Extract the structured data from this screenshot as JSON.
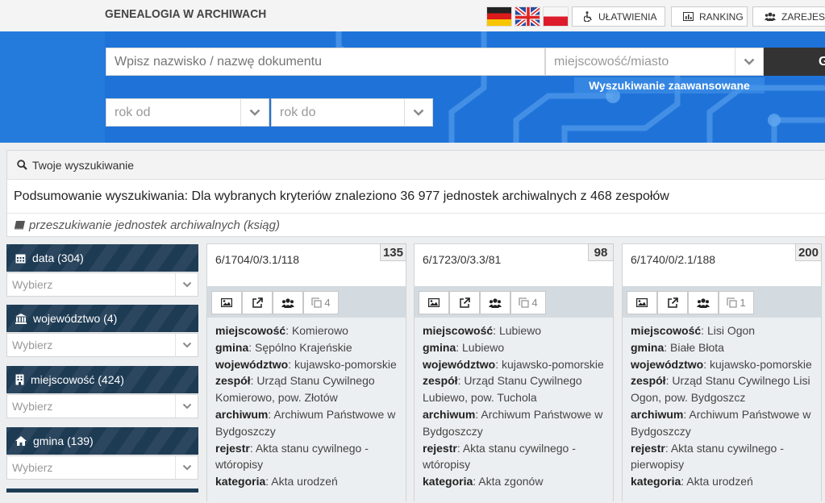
{
  "header": {
    "logo": "GENEALOGIA W ARCHIWACH",
    "buttons": {
      "accessibility": "UŁATWIENIA",
      "ranking": "RANKING",
      "register": "ZAREJESTRUJ"
    }
  },
  "search": {
    "name_placeholder": "Wpisz nazwisko / nazwę dokumentu",
    "city_placeholder": "miejscowość/miasto",
    "submit_label": "G",
    "advanced_label": "Wyszukiwanie zaawansowane",
    "year_from_placeholder": "rok od",
    "year_to_placeholder": "rok do"
  },
  "summary": {
    "heading": "Twoje wyszukiwanie",
    "text": "Podsumowanie wyszukiwania: Dla wybranych kryteriów znaleziono 36 977 jednostek archiwalnych z 468 zespołów",
    "mode": "przeszukiwanie jednostek archiwalnych (ksiąg)"
  },
  "filters": [
    {
      "label": "data (304)",
      "select": "Wybierz",
      "icon": "calendar-icon"
    },
    {
      "label": "województwo (4)",
      "select": "Wybierz",
      "icon": "bank-icon"
    },
    {
      "label": "miejscowość (424)",
      "select": "Wybierz",
      "icon": "building-icon"
    },
    {
      "label": "gmina (139)",
      "select": "Wybierz",
      "icon": "home-icon"
    }
  ],
  "field_labels": {
    "miejscowosc": "miejscowość",
    "gmina": "gmina",
    "wojewodztwo": "województwo",
    "zespol": "zespół",
    "archiwum": "archiwum",
    "rejestr": "rejestr",
    "kategoria": "kategoria"
  },
  "cards": [
    {
      "signature": "6/1704/0/3.1/118",
      "count": "135",
      "copies": "4",
      "miejscowosc": "Komierowo",
      "gmina": "Sępólno Krajeńskie",
      "wojewodztwo": "kujawsko-pomorskie",
      "zespol": "Urząd Stanu Cywilnego Komierowo, pow. Złotów",
      "archiwum": "Archiwum Państwowe w Bydgoszczy",
      "rejestr": "Akta stanu cywilnego - wtóropisy",
      "kategoria": "Akta urodzeń"
    },
    {
      "signature": "6/1723/0/3.3/81",
      "count": "98",
      "copies": "4",
      "miejscowosc": "Lubiewo",
      "gmina": "Lubiewo",
      "wojewodztwo": "kujawsko-pomorskie",
      "zespol": "Urząd Stanu Cywilnego Lubiewo, pow. Tuchola",
      "archiwum": "Archiwum Państwowe w Bydgoszczy",
      "rejestr": "Akta stanu cywilnego - wtóropisy",
      "kategoria": "Akta zgonów"
    },
    {
      "signature": "6/1740/0/2.1/188",
      "count": "200",
      "copies": "1",
      "miejscowosc": "Lisi Ogon",
      "gmina": "Białe Błota",
      "wojewodztwo": "kujawsko-pomorskie",
      "zespol": "Urząd Stanu Cywilnego Lisi Ogon, pow. Bydgoszcz",
      "archiwum": "Archiwum Państwowe w Bydgoszczy",
      "rejestr": "Akta stanu cywilnego - pierwopisy",
      "kategoria": "Akta urodzeń"
    }
  ]
}
